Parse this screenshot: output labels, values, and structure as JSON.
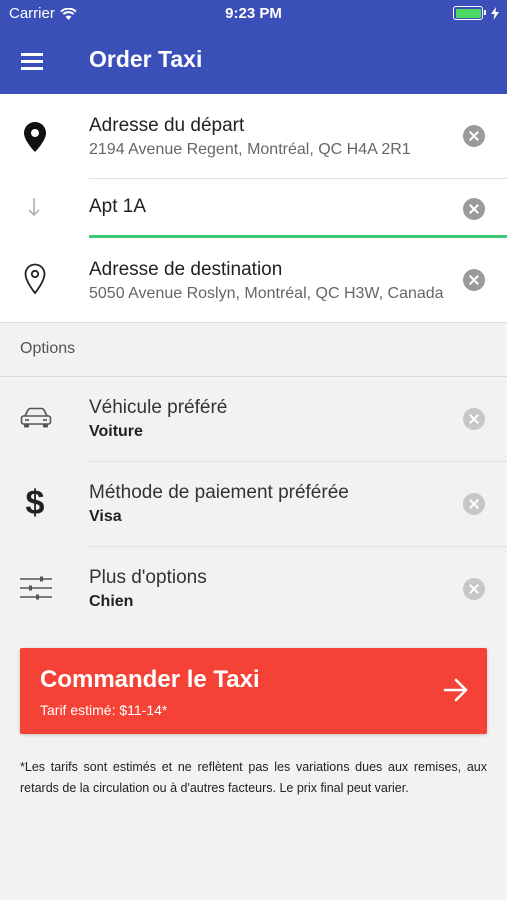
{
  "status_bar": {
    "carrier": "Carrier",
    "time": "9:23 PM",
    "battery_level": 1.0
  },
  "app_bar": {
    "title": "Order Taxi",
    "menu_icon": "hamburger-menu-icon",
    "background": "#3a50b8"
  },
  "addresses": {
    "departure": {
      "title": "Adresse du départ",
      "value": "2194 Avenue Regent, Montréal, QC H4A 2R1",
      "icon": "location-pin-filled-icon"
    },
    "apartment": {
      "value": "Apt 1A",
      "icon": "arrow-down-icon"
    },
    "destination": {
      "title": "Adresse de destination",
      "value": "5050 Avenue Roslyn, Montréal, QC H3W, Canada",
      "icon": "location-pin-outline-icon"
    }
  },
  "options": {
    "header": "Options",
    "items": [
      {
        "label": "Véhicule préféré",
        "value": "Voiture",
        "icon": "car-icon"
      },
      {
        "label": "Méthode de paiement préférée",
        "value": "Visa",
        "icon": "dollar-icon"
      },
      {
        "label": "Plus d'options",
        "value": "Chien",
        "icon": "sliders-icon"
      }
    ]
  },
  "order_button": {
    "label": "Commander le Taxi",
    "fare": "Tarif estimé: $11-14*",
    "color": "#f44336",
    "icon": "arrow-right-icon"
  },
  "disclaimer": "*Les tarifs sont estimés et ne reflètent pas les variations dues aux remises, aux retards de la circulation ou à d'autres facteurs. Le prix final peut varier.",
  "colors": {
    "primary": "#3a50b8",
    "accent_green": "#3cc872",
    "danger": "#f44336"
  }
}
